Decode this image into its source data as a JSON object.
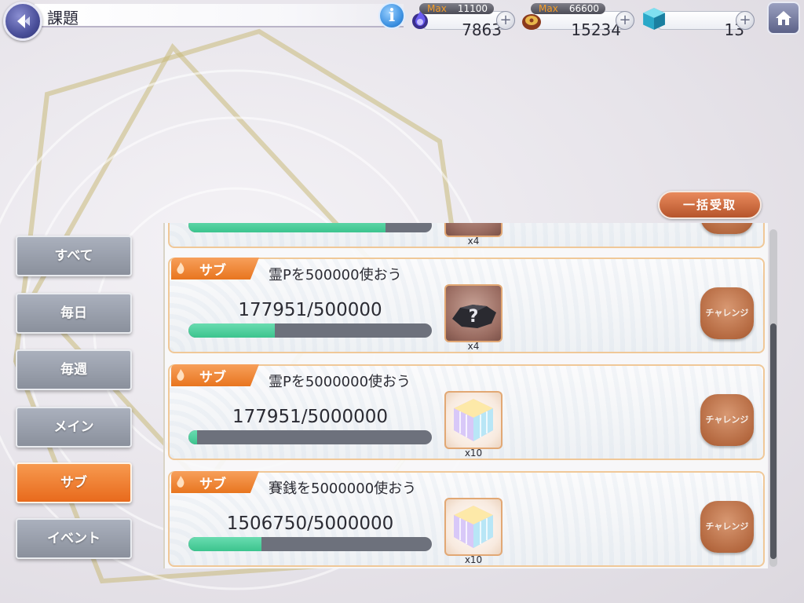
{
  "header": {
    "title": "課題",
    "info_label": "i",
    "resources": [
      {
        "name": "spirit-p",
        "max_label": "Max",
        "max_value": "11100",
        "value": "7863"
      },
      {
        "name": "coins",
        "max_label": "Max",
        "max_value": "66600",
        "value": "15234"
      },
      {
        "name": "cubes",
        "value": "13"
      }
    ],
    "plus_label": "+"
  },
  "claim_all_label": "一括受取",
  "tabs": [
    {
      "label": "すべて",
      "active": false
    },
    {
      "label": "毎日",
      "active": false
    },
    {
      "label": "毎週",
      "active": false
    },
    {
      "label": "メイン",
      "active": false
    },
    {
      "label": "サブ",
      "active": true
    },
    {
      "label": "イベント",
      "active": false
    }
  ],
  "partial_quest": {
    "reward_qty": "x4",
    "progress_fraction": 0.81
  },
  "quests": [
    {
      "tag": "サブ",
      "title": "霊Pを500000使おう",
      "progress": "177951/500000",
      "progress_fraction": 0.356,
      "reward_type": "rock",
      "reward_qty": "x4",
      "button": "チャレンジ"
    },
    {
      "tag": "サブ",
      "title": "霊Pを5000000使おう",
      "progress": "177951/5000000",
      "progress_fraction": 0.036,
      "reward_type": "cube",
      "reward_qty": "x10",
      "button": "チャレンジ"
    },
    {
      "tag": "サブ",
      "title": "賽銭を5000000使おう",
      "progress": "1506750/5000000",
      "progress_fraction": 0.301,
      "reward_type": "cube",
      "reward_qty": "x10",
      "button": "チャレンジ"
    }
  ],
  "colors": {
    "accent": "#E8751F",
    "progress_fill": "#3CC48E",
    "tab_active": "#F08A3A"
  }
}
